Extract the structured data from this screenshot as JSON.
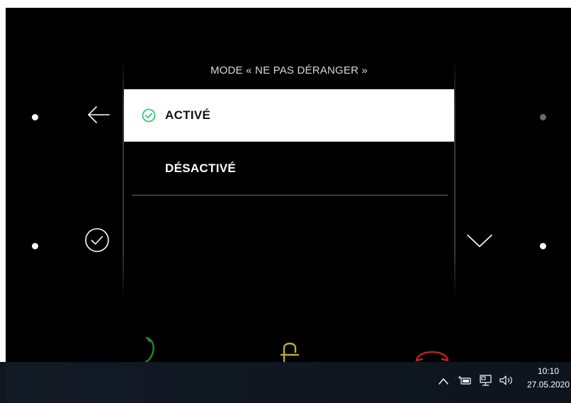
{
  "dialog": {
    "title": "MODE « NE PAS DÉRANGER »",
    "options": [
      {
        "label": "ACTIVÉ",
        "selected": true
      },
      {
        "label": "DÉSACTIVÉ",
        "selected": false
      }
    ]
  },
  "colors": {
    "accent_green": "#2ecc71",
    "call_green": "#1f8a2a",
    "door_yellow": "#b9b126",
    "hangup_red": "#b8231e",
    "screen_bg": "#000000"
  },
  "left_controls": [
    {
      "icon": "arrow-left-icon"
    },
    {
      "icon": "check-circle-icon"
    }
  ],
  "right_controls": [
    {
      "icon": "chevron-down-icon"
    }
  ],
  "bottom_bar": [
    {
      "icon": "phone-answer-icon"
    },
    {
      "icon": "door-lock-icon"
    },
    {
      "icon": "phone-hangup-icon"
    }
  ],
  "taskbar": {
    "time": "10:10",
    "date": "27.05.2020",
    "tray_icons": [
      "chevron-up-icon",
      "battery-icon",
      "network-icon",
      "volume-icon"
    ]
  }
}
